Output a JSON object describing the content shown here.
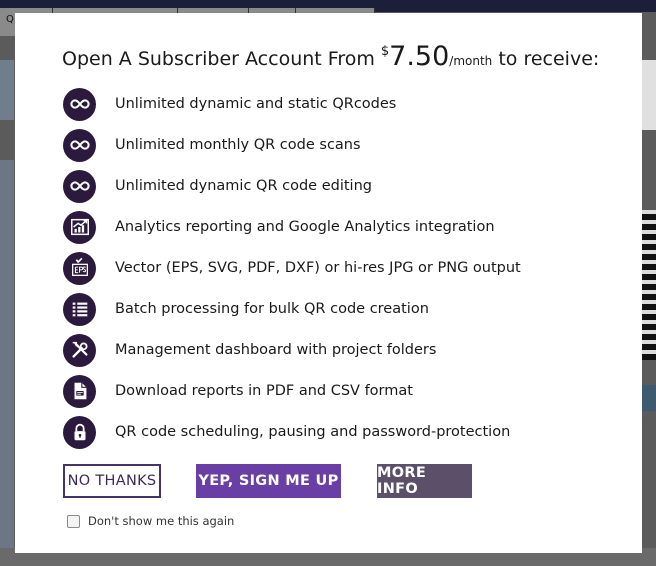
{
  "background": {
    "tab_labels": [
      "Q"
    ]
  },
  "modal": {
    "headline_before": "Open A Subscriber Account From ",
    "price_currency": "$",
    "price_amount": "7.50",
    "price_period": "/month",
    "headline_after": " to receive:",
    "features": [
      {
        "icon": "infinity-icon",
        "text": "Unlimited dynamic and static QRcodes"
      },
      {
        "icon": "infinity-icon",
        "text": "Unlimited monthly QR code scans"
      },
      {
        "icon": "infinity-icon",
        "text": "Unlimited dynamic QR code editing"
      },
      {
        "icon": "analytics-chart-icon",
        "text": "Analytics reporting and Google Analytics integration"
      },
      {
        "icon": "eps-file-icon",
        "text": "Vector (EPS, SVG, PDF, DXF) or hi-res JPG or PNG output"
      },
      {
        "icon": "list-icon",
        "text": "Batch processing for bulk QR code creation"
      },
      {
        "icon": "tools-icon",
        "text": "Management dashboard with project folders"
      },
      {
        "icon": "document-icon",
        "text": "Download reports in PDF and CSV format"
      },
      {
        "icon": "lock-icon",
        "text": "QR code scheduling, pausing and password-protection"
      }
    ],
    "buttons": {
      "no_thanks": "NO THANKS",
      "sign_up": "YEP, SIGN ME UP",
      "more_info": "MORE INFO"
    },
    "dont_show_label": "Don't show me this again"
  },
  "colors": {
    "icon_bg": "#2b1a3d",
    "primary": "#6a3fa5",
    "secondary": "#5c4f69",
    "outline": "#45346a"
  }
}
